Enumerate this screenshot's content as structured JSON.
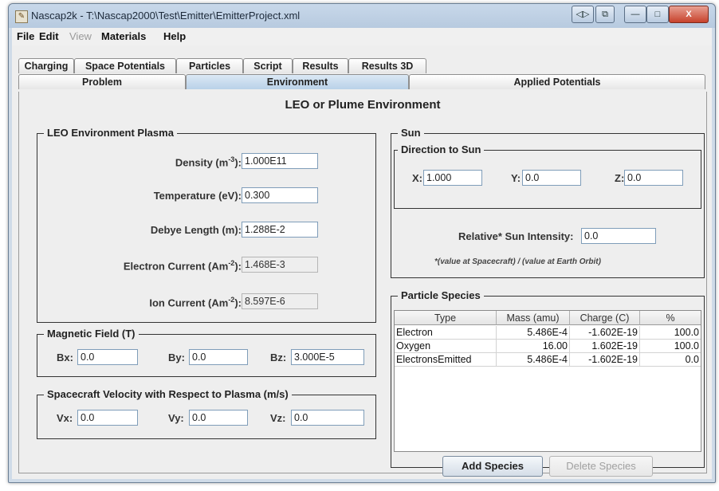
{
  "window": {
    "title": "Nascap2k - T:\\Nascap2000\\Test\\Emitter\\EmitterProject.xml",
    "app_icon": "nascap-app-icon"
  },
  "title_buttons": {
    "restore_down": "◁▷",
    "copy": "⧉",
    "minimize": "—",
    "maximize": "□",
    "close": "X"
  },
  "menu": {
    "file": "File",
    "edit": "Edit",
    "view": "View",
    "materials": "Materials",
    "help": "Help"
  },
  "tabs_row1": [
    "Charging",
    "Space Potentials",
    "Particles",
    "Script",
    "Results",
    "Results 3D"
  ],
  "tabs_row2": [
    "Problem",
    "Environment",
    "Applied Potentials"
  ],
  "selected_tab": "Environment",
  "heading": "LEO or Plume Environment",
  "plasma": {
    "title": "LEO Environment Plasma",
    "density_label": "Density (m",
    "density_exp": "-3",
    "density_suffix": "):",
    "density": "1.000E11",
    "temperature_label": "Temperature (eV):",
    "temperature": "0.300",
    "debye_label": "Debye Length (m):",
    "debye": "1.288E-2",
    "electron_label": "Electron Current (Am",
    "electron_exp": "-2",
    "electron_suffix": "):",
    "electron": "1.468E-3",
    "ion_label": "Ion Current (Am",
    "ion_exp": "-2",
    "ion_suffix": "):",
    "ion": "8.597E-6"
  },
  "magnetic": {
    "title": "Magnetic Field (T)",
    "bx_label": "Bx:",
    "bx": "0.0",
    "by_label": "By:",
    "by": "0.0",
    "bz_label": "Bz:",
    "bz": "3.000E-5"
  },
  "velocity": {
    "title": "Spacecraft Velocity with Respect to Plasma (m/s)",
    "vx_label": "Vx:",
    "vx": "0.0",
    "vy_label": "Vy:",
    "vy": "0.0",
    "vz_label": "Vz:",
    "vz": "0.0"
  },
  "sun": {
    "title": "Sun",
    "direction_title": "Direction to Sun",
    "x_label": "X:",
    "x": "1.000",
    "y_label": "Y:",
    "y": "0.0",
    "z_label": "Z:",
    "z": "0.0",
    "intensity_label": "Relative* Sun Intensity:",
    "intensity": "0.0",
    "note": "*(value at Spacecraft) / (value at Earth Orbit)"
  },
  "species": {
    "title": "Particle Species",
    "columns": [
      "Type",
      "Mass (amu)",
      "Charge (C)",
      "%"
    ],
    "rows": [
      [
        "Electron",
        "5.486E-4",
        "-1.602E-19",
        "100.0"
      ],
      [
        "Oxygen",
        "16.00",
        "1.602E-19",
        "100.0"
      ],
      [
        "ElectronsEmitted",
        "5.486E-4",
        "-1.602E-19",
        "0.0"
      ]
    ],
    "add_button": "Add Species",
    "delete_button": "Delete Species"
  }
}
